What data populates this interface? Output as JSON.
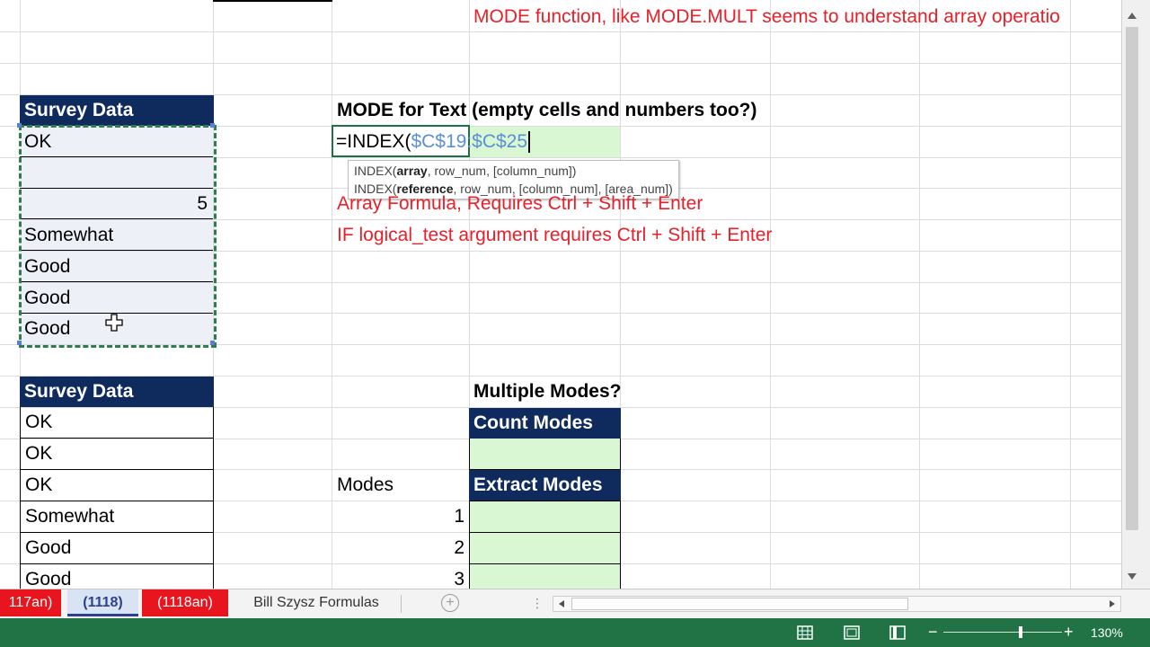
{
  "note_top": "MODE function, like MODE.MULT seems to understand array operatio",
  "table1": {
    "header": "Survey Data",
    "rows": [
      "OK",
      "",
      "5",
      "Somewhat",
      "Good",
      "Good",
      "Good"
    ]
  },
  "mode_text_title": "MODE for Text (empty cells and numbers too?)",
  "formula": {
    "prefix": "=INDEX(",
    "ref": "$C$19:$C$25"
  },
  "tooltip": {
    "line1_fn": "INDEX(",
    "line1_bold": "array",
    "line1_rest": ", row_num, [column_num])",
    "line2_fn": "INDEX(",
    "line2_bold": "reference",
    "line2_rest": ", row_num, [column_num], [area_num])"
  },
  "notes": {
    "array_formula": "Array Formula, Requires Ctrl + Shift + Enter",
    "if_logical": "IF logical_test argument requires Ctrl + Shift + Enter"
  },
  "table2": {
    "header": "Survey Data",
    "rows": [
      "OK",
      "OK",
      "OK",
      "Somewhat",
      "Good",
      "Good"
    ]
  },
  "multiple_modes": {
    "title": "Multiple Modes?",
    "count_header": "Count Modes",
    "extract_header": "Extract Modes",
    "modes_label": "Modes",
    "numbers": [
      "1",
      "2",
      "3"
    ]
  },
  "tabs": {
    "t1": "117an)",
    "t2": "(1118)",
    "t3": "(1118an)",
    "t4": "Bill Szysz Formulas"
  },
  "status": {
    "zoom": "130%"
  },
  "colors": {
    "header_bg": "#0f2a5c",
    "green_fill": "#d9f7d2",
    "red_text": "#e8202a",
    "statusbar": "#217346",
    "tab_red": "#e8151e"
  }
}
